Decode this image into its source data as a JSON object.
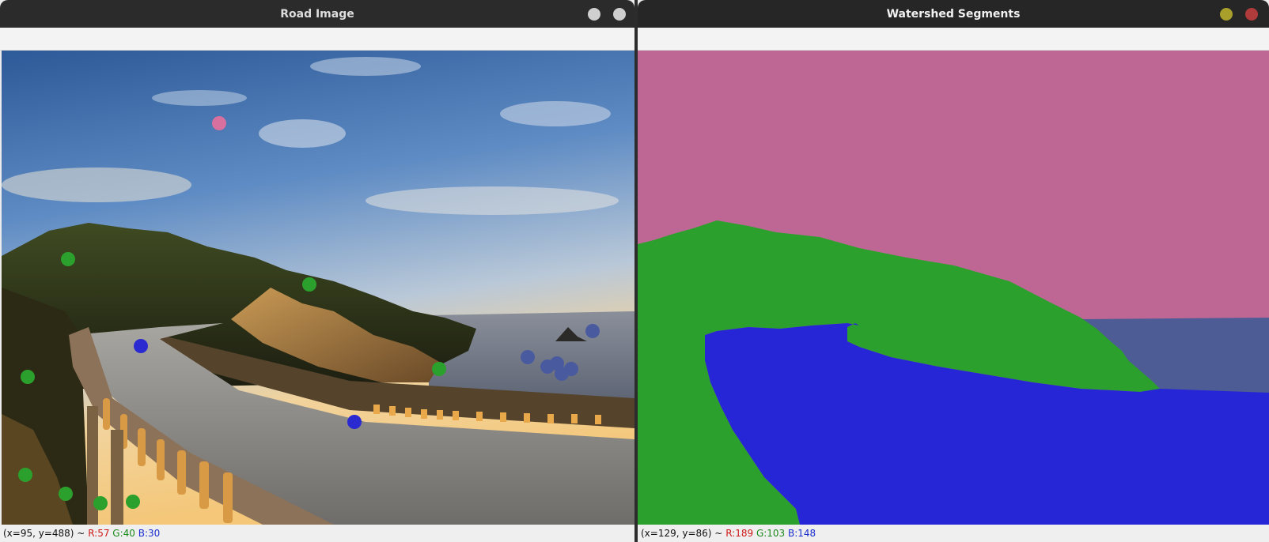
{
  "left_window": {
    "title": "Road Image",
    "status": {
      "coords": "(x=95, y=488) ~",
      "r": "R:57",
      "g": "G:40",
      "b": "B:30"
    }
  },
  "right_window": {
    "title": "Watershed Segments",
    "status": {
      "coords": "(x=129, y=86) ~",
      "r": "R:189",
      "g": "G:103",
      "b": "B:148"
    }
  },
  "colors": {
    "segment_sky": "#be6794",
    "segment_land": "#2ca02c",
    "segment_road": "#2626d6",
    "segment_sea": "#4e5c96",
    "marker_sky": "#d7709e",
    "marker_land": "#2ca02c",
    "marker_road": "#2a2ad0",
    "marker_sea": "#4a5a9e"
  }
}
